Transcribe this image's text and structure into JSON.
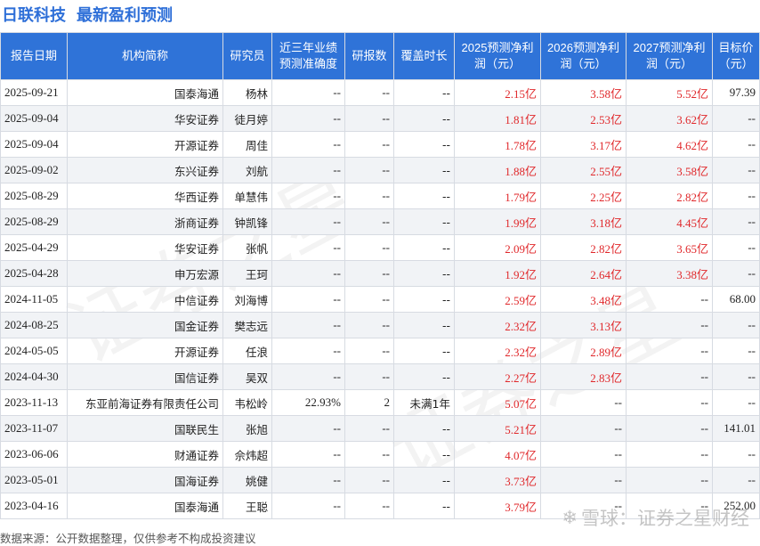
{
  "title": {
    "company": "日联科技",
    "heading": "最新盈利预测"
  },
  "table": {
    "headers": [
      "报告日期",
      "机构简称",
      "研究员",
      "近三年业绩预测准确度",
      "研报数",
      "覆盖时长",
      "2025预测净利润（元）",
      "2026预测净利润（元）",
      "2027预测净利润（元）",
      "目标价（元）"
    ],
    "rows": [
      [
        "2025-09-21",
        "国泰海通",
        "杨林",
        "--",
        "--",
        "--",
        "2.15亿",
        "3.58亿",
        "5.52亿",
        "97.39"
      ],
      [
        "2025-09-04",
        "华安证券",
        "徒月婷",
        "--",
        "--",
        "--",
        "1.81亿",
        "2.53亿",
        "3.62亿",
        "--"
      ],
      [
        "2025-09-04",
        "开源证券",
        "周佳",
        "--",
        "--",
        "--",
        "1.78亿",
        "3.17亿",
        "4.62亿",
        "--"
      ],
      [
        "2025-09-02",
        "东兴证券",
        "刘航",
        "--",
        "--",
        "--",
        "1.88亿",
        "2.55亿",
        "3.58亿",
        "--"
      ],
      [
        "2025-08-29",
        "华西证券",
        "单慧伟",
        "--",
        "--",
        "--",
        "1.79亿",
        "2.25亿",
        "2.82亿",
        "--"
      ],
      [
        "2025-08-29",
        "浙商证券",
        "钟凯锋",
        "--",
        "--",
        "--",
        "1.99亿",
        "3.18亿",
        "4.45亿",
        "--"
      ],
      [
        "2025-04-29",
        "华安证券",
        "张帆",
        "--",
        "--",
        "--",
        "2.09亿",
        "2.82亿",
        "3.65亿",
        "--"
      ],
      [
        "2025-04-28",
        "申万宏源",
        "王珂",
        "--",
        "--",
        "--",
        "1.92亿",
        "2.64亿",
        "3.38亿",
        "--"
      ],
      [
        "2024-11-05",
        "中信证券",
        "刘海博",
        "--",
        "--",
        "--",
        "2.59亿",
        "3.48亿",
        "--",
        "68.00"
      ],
      [
        "2024-08-25",
        "国金证券",
        "樊志远",
        "--",
        "--",
        "--",
        "2.32亿",
        "3.13亿",
        "--",
        "--"
      ],
      [
        "2024-05-05",
        "开源证券",
        "任浪",
        "--",
        "--",
        "--",
        "2.32亿",
        "2.89亿",
        "--",
        "--"
      ],
      [
        "2024-04-30",
        "国信证券",
        "吴双",
        "--",
        "--",
        "--",
        "2.27亿",
        "2.83亿",
        "--",
        "--"
      ],
      [
        "2023-11-13",
        "东亚前海证券有限责任公司",
        "韦松岭",
        "22.93%",
        "2",
        "未满1年",
        "5.07亿",
        "--",
        "--",
        "--"
      ],
      [
        "2023-11-07",
        "国联民生",
        "张旭",
        "--",
        "--",
        "--",
        "5.21亿",
        "--",
        "--",
        "141.01"
      ],
      [
        "2023-06-06",
        "财通证券",
        "佘炜超",
        "--",
        "--",
        "--",
        "4.07亿",
        "--",
        "--",
        "--"
      ],
      [
        "2023-05-01",
        "国海证券",
        "姚健",
        "--",
        "--",
        "--",
        "3.73亿",
        "--",
        "--",
        "--"
      ],
      [
        "2023-04-16",
        "国泰海通",
        "王聪",
        "--",
        "--",
        "--",
        "3.79亿",
        "--",
        "--",
        "252.00"
      ]
    ]
  },
  "footer": {
    "source": "数据来源：公开数据整理，仅供参考不构成投资建议"
  },
  "watermark": {
    "brand": "雪球：证券之星财经",
    "logo": "❄",
    "text": "证券之星"
  },
  "colors": {
    "header_bg": "#2f73d8",
    "accent": "#2e6fd8",
    "forecast": "#e0282b"
  }
}
